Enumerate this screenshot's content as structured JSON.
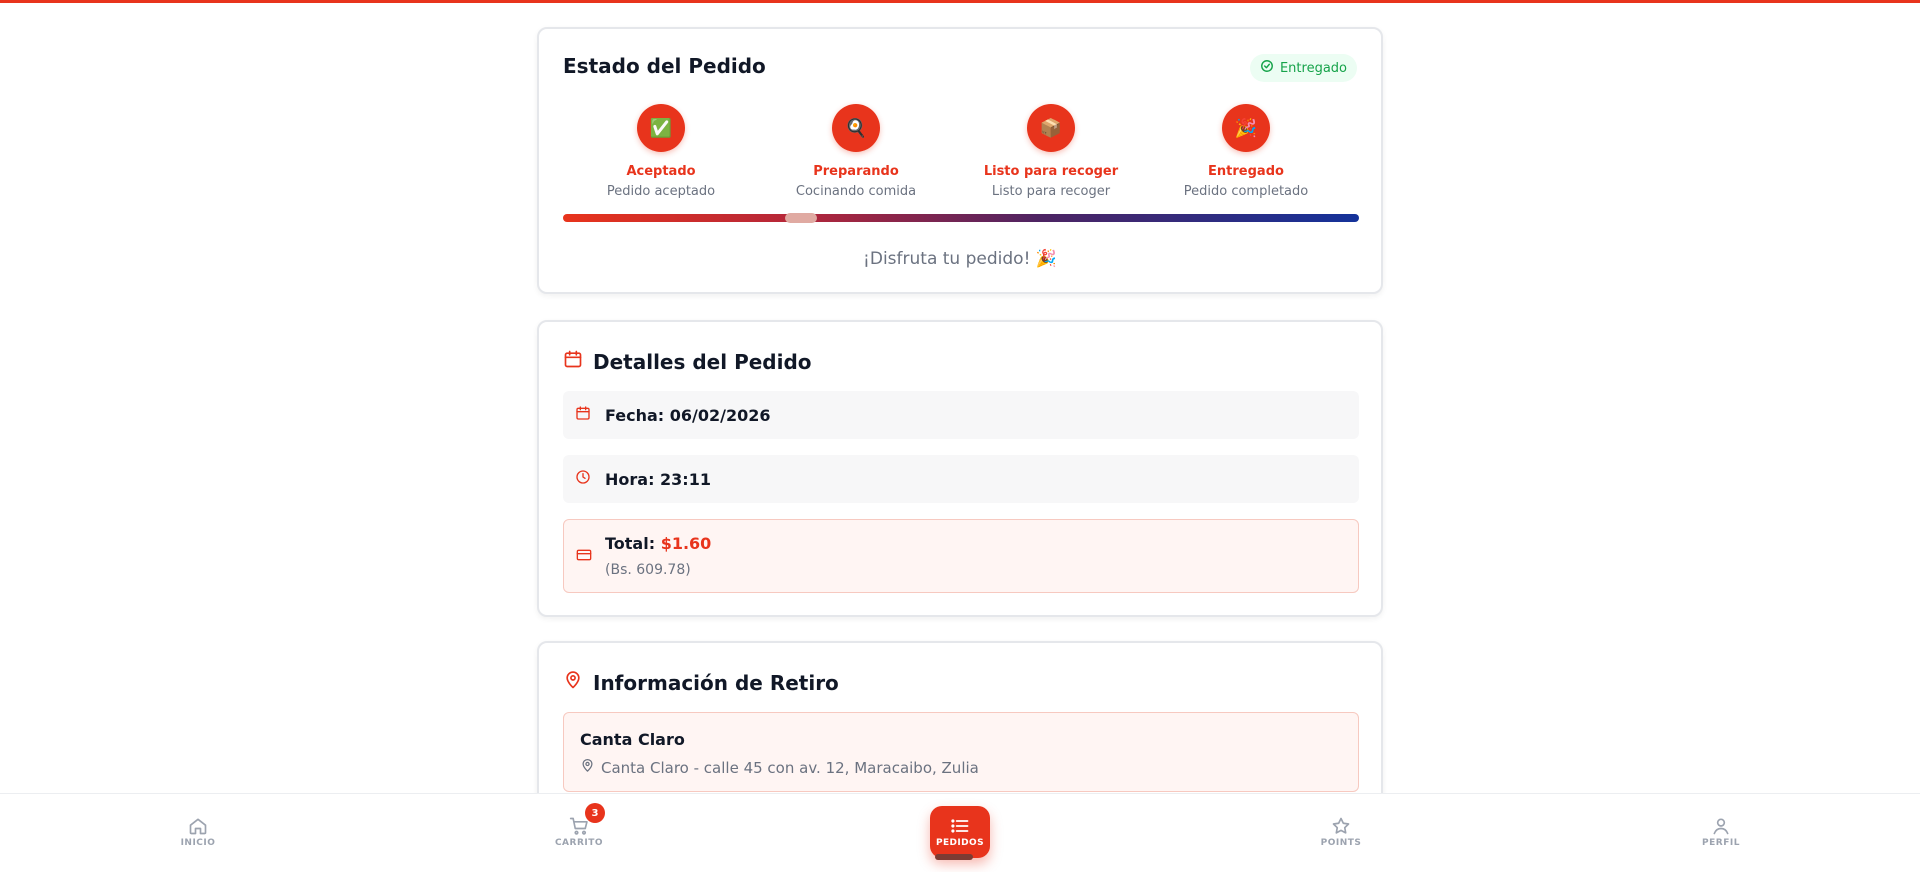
{
  "status_card": {
    "title": "Estado del Pedido",
    "badge": "Entregado",
    "steps": [
      {
        "icon": "✅",
        "title": "Aceptado",
        "desc": "Pedido aceptado"
      },
      {
        "icon": "🍳",
        "title": "Preparando",
        "desc": "Cocinando comida"
      },
      {
        "icon": "📦",
        "title": "Listo para recoger",
        "desc": "Listo para recoger"
      },
      {
        "icon": "🎉",
        "title": "Entregado",
        "desc": "Pedido completado"
      }
    ],
    "progress": 1.0,
    "message": "¡Disfruta tu pedido! 🎉"
  },
  "details_card": {
    "title": "Detalles del Pedido",
    "date": "Fecha: 06/02/2026",
    "time": "Hora: 23:11",
    "total_label": "Total:",
    "total_value": "$1.60",
    "total_bs": "(Bs. 609.78)"
  },
  "pickup_card": {
    "title": "Información de Retiro",
    "store": "Canta Claro",
    "address": "Canta Claro - calle 45 con av. 12, Maracaibo, Zulia"
  },
  "nav": {
    "home": "INICIO",
    "cart": "CARRITO",
    "cart_count": "3",
    "orders": "PEDIDOS",
    "points": "POINTS",
    "profile": "PERFIL"
  },
  "colors": {
    "accent": "#e8341c",
    "success": "#16a34a",
    "progress_end": "#14329a"
  }
}
